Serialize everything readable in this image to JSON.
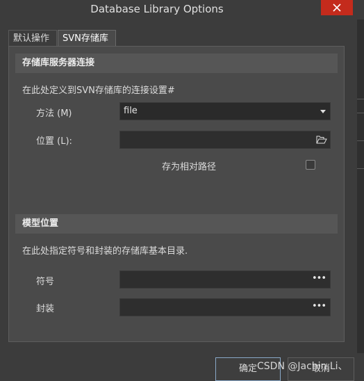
{
  "window": {
    "title": "Database Library Options"
  },
  "tabs": [
    {
      "label": "默认操作",
      "active": false
    },
    {
      "label": "SVN存储库",
      "active": true
    }
  ],
  "svn_section": {
    "header": "存储库服务器连接",
    "description": "在此处定义到SVN存储库的连接设置#",
    "method_label": "方法 (M)",
    "method_value": "file",
    "location_label": "位置 (L):",
    "location_value": "",
    "relative_path_label": "存为相对路径",
    "relative_path_checked": false
  },
  "model_section": {
    "header": "模型位置",
    "description": "在此处指定符号和封装的存储库基本目录.",
    "symbol_label": "符号",
    "symbol_value": "",
    "footprint_label": "封装",
    "footprint_value": ""
  },
  "buttons": {
    "ok": "确定",
    "cancel": "取消"
  },
  "watermark": "CSDN @Jachin Li、",
  "colors": {
    "background": "#3c3c3c",
    "panel": "#4a4a4a",
    "close": "#c42b1c",
    "field": "#2e2e2e"
  }
}
